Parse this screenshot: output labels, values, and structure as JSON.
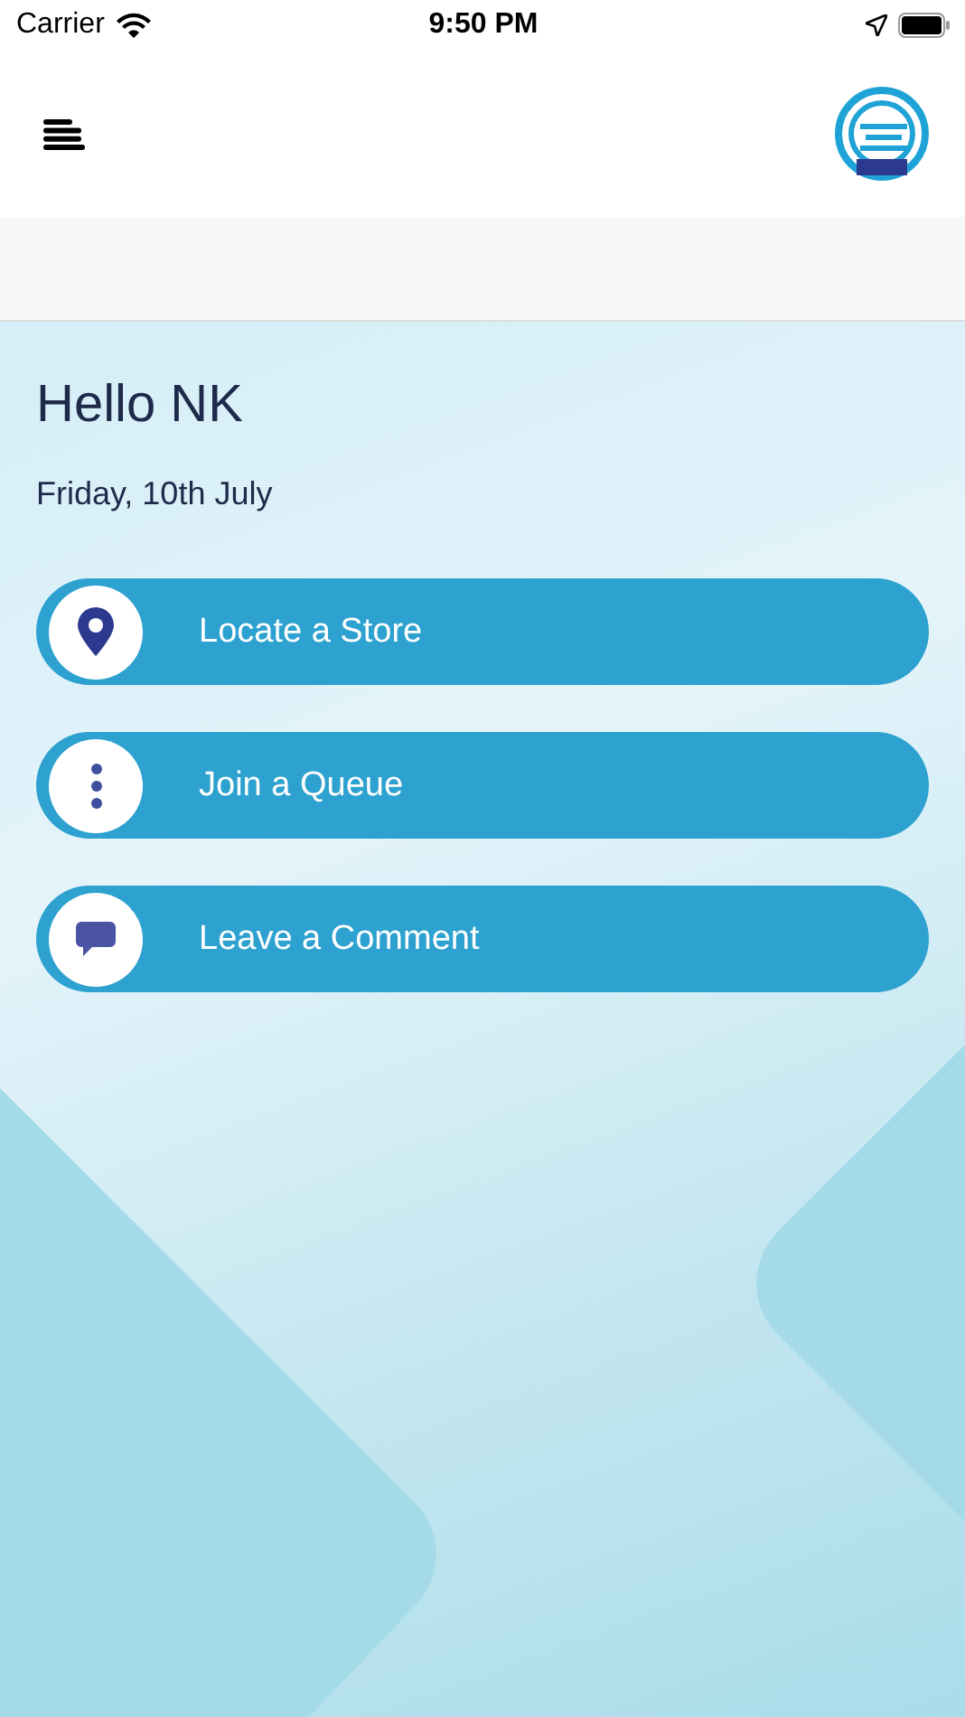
{
  "status_bar": {
    "carrier": "Carrier",
    "time": "9:50 PM"
  },
  "greeting": "Hello NK",
  "date": "Friday, 10th July",
  "actions": [
    {
      "label": "Locate a Store",
      "kind": "pin"
    },
    {
      "label": "Join a Queue",
      "kind": "dots"
    },
    {
      "label": "Leave a Comment",
      "kind": "comment"
    }
  ]
}
